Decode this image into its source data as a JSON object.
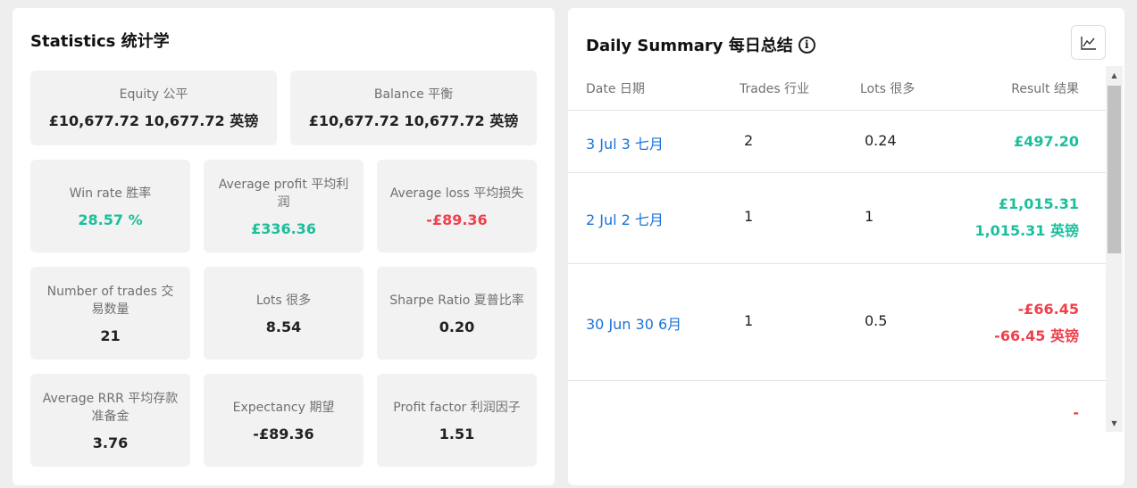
{
  "statistics": {
    "title": "Statistics  统计学",
    "equity": {
      "label": "Equity  公平",
      "value": "£10,677.72  10,677.72 英镑"
    },
    "balance": {
      "label": "Balance  平衡",
      "value": "£10,677.72  10,677.72 英镑"
    },
    "win_rate": {
      "label": "Win rate  胜率",
      "value": "28.57 %"
    },
    "average_profit": {
      "label": "Average profit  平均利润",
      "value": "£336.36"
    },
    "average_loss": {
      "label": "Average loss  平均损失",
      "value": "-£89.36"
    },
    "number_of_trades": {
      "label": "Number of trades  交易数量",
      "value": "21"
    },
    "lots": {
      "label": "Lots  很多",
      "value": "8.54"
    },
    "sharpe_ratio": {
      "label": "Sharpe Ratio  夏普比率",
      "value": "0.20"
    },
    "average_rrr": {
      "label": "Average RRR  平均存款准备金",
      "value": "3.76"
    },
    "expectancy": {
      "label": "Expectancy  期望",
      "value": "-£89.36"
    },
    "profit_factor": {
      "label": "Profit factor  利润因子",
      "value": "1.51"
    },
    "colors": {
      "positive": "#1bbf9c",
      "negative": "#f0404b"
    }
  },
  "daily_summary": {
    "title": "Daily Summary  每日总结",
    "info_icon": "info-icon",
    "chart_button_icon": "line-chart-icon",
    "columns": [
      "Date  日期",
      "Trades  行业",
      "Lots  很多",
      "Result  结果"
    ],
    "rows": [
      {
        "date": "3 Jul  3 七月",
        "trades": "2",
        "lots": "0.24",
        "result": "£497.20",
        "status": "positive"
      },
      {
        "date": "2 Jul  2 七月",
        "trades": "1",
        "lots": "1",
        "result": "£1,015.31  1,015.31 英镑",
        "status": "positive"
      },
      {
        "date": "30 Jun  30 6月",
        "trades": "1",
        "lots": "0.5",
        "result": "-£66.45  -66.45 英镑",
        "status": "negative"
      },
      {
        "date": "",
        "trades": "",
        "lots": "",
        "result": "-",
        "status": "negative"
      }
    ],
    "link_color": "#1a73d9"
  }
}
